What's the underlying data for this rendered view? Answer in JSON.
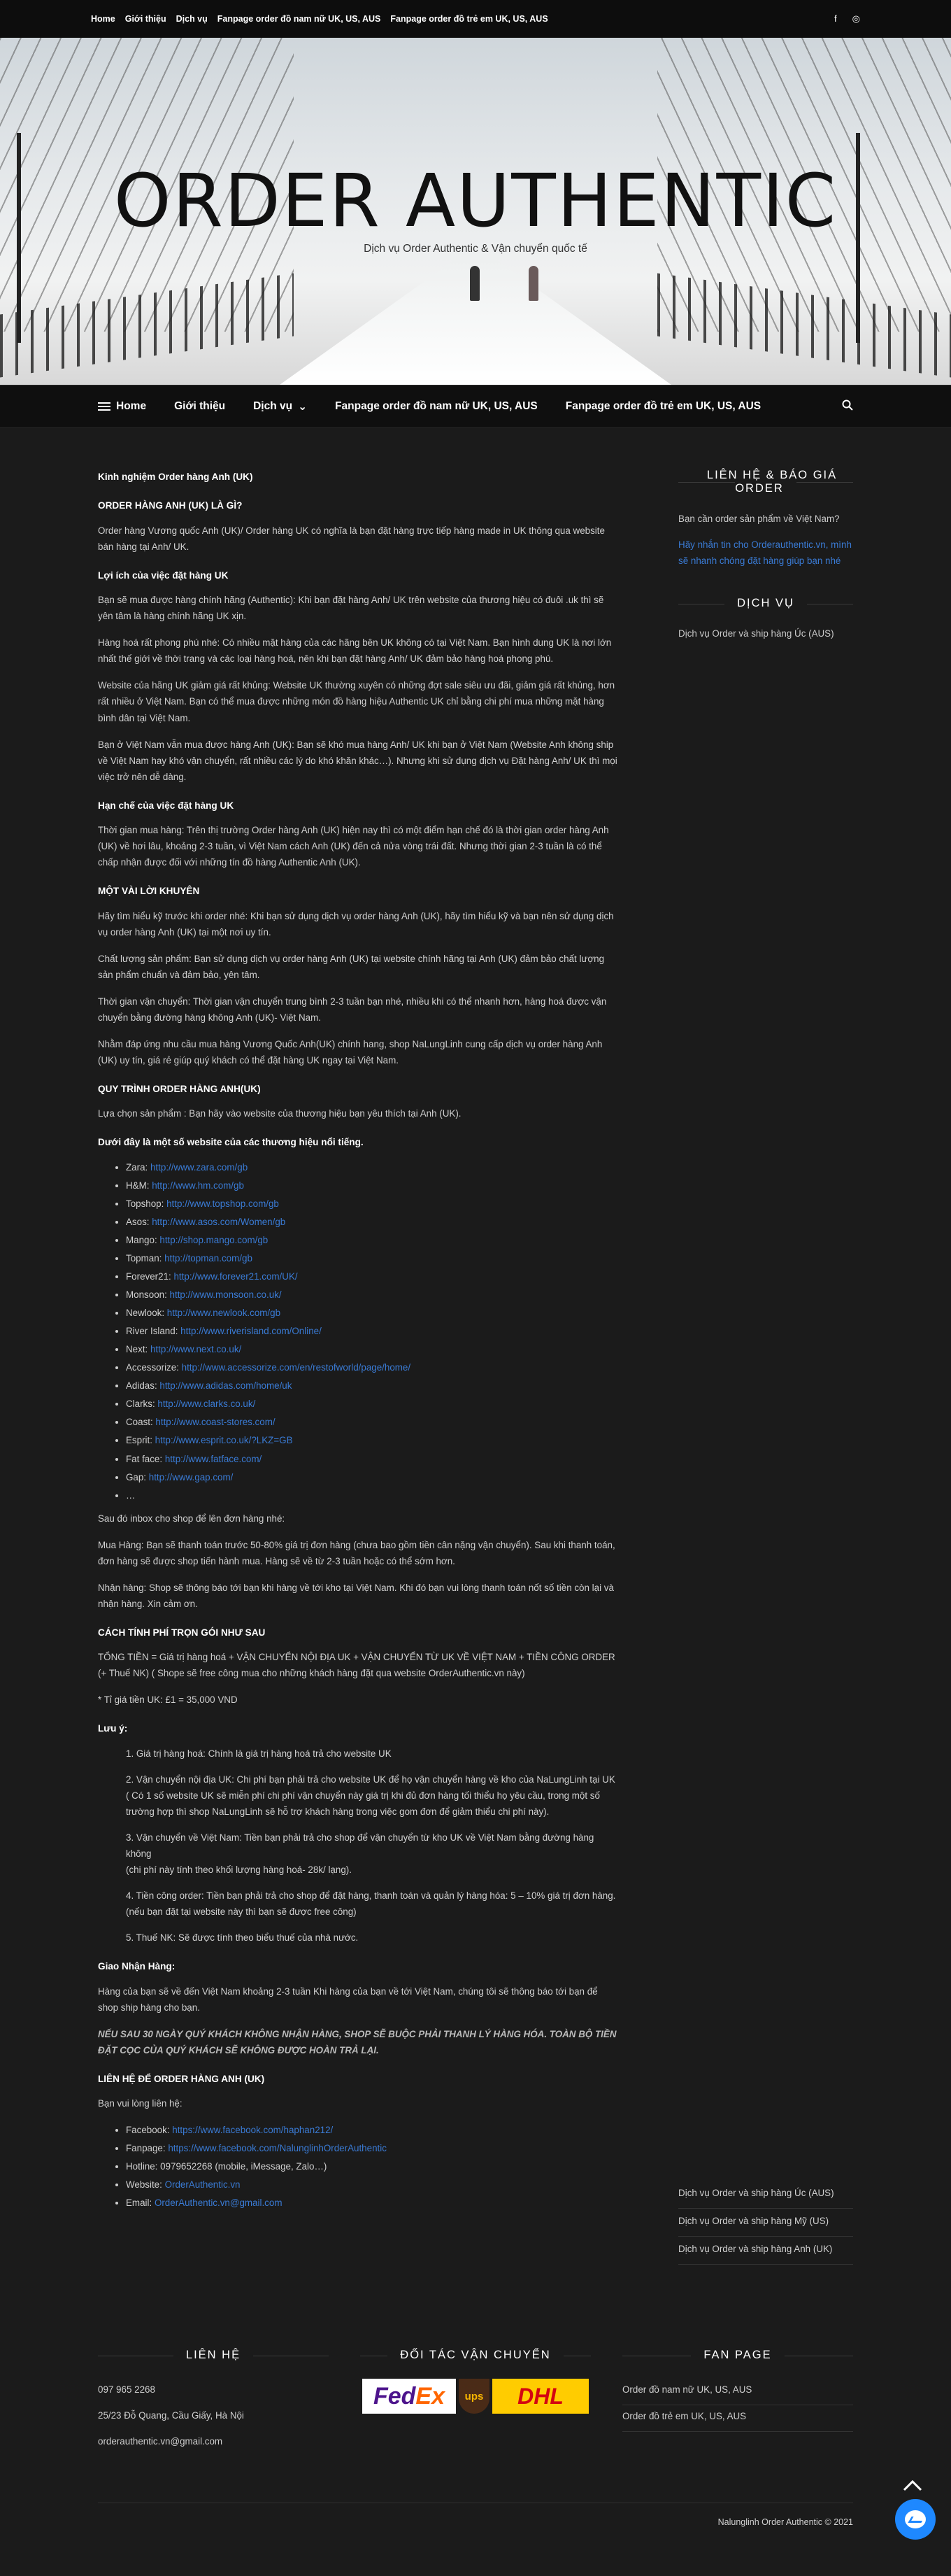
{
  "topbar": {
    "menu": [
      "Home",
      "Giới thiệu",
      "Dịch vụ",
      "Fanpage order đồ nam nữ UK, US, AUS",
      "Fanpage order đồ trẻ em UK, US, AUS"
    ],
    "social": [
      "f",
      "◎"
    ]
  },
  "hero": {
    "title": "ORDER AUTHENTIC",
    "tagline": "Dịch vụ Order Authentic & Vận chuyển quốc tế"
  },
  "mainnav": {
    "home": "Home",
    "about": "Giới thiệu",
    "services": "Dịch vụ",
    "fanpage1": "Fanpage order đồ nam nữ UK, US, AUS",
    "fanpage2": "Fanpage order đồ trẻ em UK, US, AUS"
  },
  "article": {
    "h_main": "Kinh nghiệm Order hàng Anh (UK)",
    "h_what": "ORDER HÀNG ANH (UK) LÀ GÌ?",
    "p_what": "Order hàng Vương quốc Anh (UK)/ Order hàng UK có nghĩa là bạn đặt hàng trực tiếp hàng made in UK thông qua website bán hàng tại Anh/ UK.",
    "h_benefit": "Lợi ích của việc đặt hàng UK",
    "p_b1": "Bạn sẽ mua được hàng chính hãng (Authentic): Khi bạn đặt hàng Anh/ UK trên website của thương hiệu có đuôi .uk thì sẽ yên tâm là hàng chính hãng UK xịn.",
    "p_b2": "Hàng hoá rất phong phú nhé: Có nhiều mặt hàng của các hãng bên UK không có tại Việt Nam. Bạn hình dung UK là nơi lớn nhất thế giới về thời trang và các loại hàng hoá, nên khi bạn đặt hàng Anh/ UK đảm bảo hàng hoá phong phú.",
    "p_b3": "Website của hãng UK giảm giá rất khủng: Website UK thường xuyên có những đợt sale siêu ưu đãi, giảm giá rất khủng, hơn rất nhiều ở Việt Nam. Bạn có thể mua được những món đồ hàng hiệu Authentic UK chỉ bằng chi phí mua những mặt hàng bình dân tại Việt Nam.",
    "p_b4": "Bạn ở Việt Nam vẫn mua được hàng Anh (UK): Bạn sẽ khó mua hàng Anh/ UK khi bạn ở Việt Nam (Website Anh không ship về Việt Nam hay khó vận chuyển, rất nhiều các lý do khó khăn khác…). Nhưng khi sử dụng dịch vụ Đặt hàng Anh/ UK thì mọi việc trở nên dễ dàng.",
    "h_limit": "Hạn chế của việc đặt hàng UK",
    "p_limit": "Thời gian mua hàng: Trên thị trường Order hàng Anh (UK) hiện nay thì có một điểm hạn chế đó là thời gian order hàng Anh (UK) về hơi lâu, khoảng 2-3 tuần, vì Việt Nam cách Anh (UK) đến cả nửa vòng trái đất. Nhưng thời gian 2-3 tuần là có thể chấp nhận được đối với những tín đồ hàng Authentic Anh (UK).",
    "h_advice": "MỘT VÀI LỜI KHUYÊN",
    "p_a1": "Hãy tìm hiểu kỹ trước khi order nhé: Khi bạn sử dụng dịch vụ order hàng Anh (UK), hãy tìm hiểu kỹ và bạn nên sử dụng dịch vụ order hàng Anh (UK) tại một nơi uy tín.",
    "p_a2": "Chất lượng sản phẩm: Bạn sử dụng dịch vụ order hàng Anh (UK) tại website chính hãng tại Anh (UK) đảm bảo chất lượng sản phẩm chuẩn và đảm bảo, yên tâm.",
    "p_a3": "Thời gian vận chuyển: Thời gian vận chuyển trung bình 2-3 tuần bạn nhé, nhiều khi có thể nhanh hơn, hàng hoá được vận chuyển bằng đường hàng không Anh (UK)- Việt Nam.",
    "p_a4": "Nhằm đáp ứng nhu cầu mua hàng Vương Quốc Anh(UK) chính hang, shop NaLungLinh cung cấp dịch vụ order hàng Anh (UK) uy tín, giá rẻ giúp quý khách có thể đặt hàng UK ngay tại Việt Nam.",
    "h_process": "QUY TRÌNH ORDER HÀNG ANH(UK)",
    "p_process": "Lựa chọn sản phẩm : Bạn hãy vào website của thương hiệu bạn yêu thích tại Anh (UK).",
    "h_brands": "Dưới đây là một số website của các thương hiệu nổi tiếng.",
    "brands": [
      {
        "name": "Zara: ",
        "url": "http://www.zara.com/gb"
      },
      {
        "name": "H&M: ",
        "url": "http://www.hm.com/gb"
      },
      {
        "name": "Topshop: ",
        "url": "http://www.topshop.com/gb"
      },
      {
        "name": "Asos: ",
        "url": "http://www.asos.com/Women/gb"
      },
      {
        "name": "Mango: ",
        "url": "http://shop.mango.com/gb"
      },
      {
        "name": "Topman: ",
        "url": "http://topman.com/gb"
      },
      {
        "name": "Forever21: ",
        "url": "http://www.forever21.com/UK/"
      },
      {
        "name": "Monsoon: ",
        "url": "http://www.monsoon.co.uk/"
      },
      {
        "name": "Newlook: ",
        "url": "http://www.newlook.com/gb"
      },
      {
        "name": "River Island: ",
        "url": "http://www.riverisland.com/Online/"
      },
      {
        "name": "Next: ",
        "url": "http://www.next.co.uk/"
      },
      {
        "name": "Accessorize: ",
        "url": "http://www.accessorize.com/en/restofworld/page/home/"
      },
      {
        "name": "Adidas: ",
        "url": "http://www.adidas.com/home/uk"
      },
      {
        "name": "Clarks: ",
        "url": "http://www.clarks.co.uk/"
      },
      {
        "name": "Coast: ",
        "url": "http://www.coast-stores.com/"
      },
      {
        "name": "Esprit: ",
        "url": "http://www.esprit.co.uk/?LKZ=GB"
      },
      {
        "name": "Fat face: ",
        "url": "http://www.fatface.com/"
      },
      {
        "name": "Gap: ",
        "url": "http://www.gap.com/"
      },
      {
        "name": "…",
        "url": ""
      }
    ],
    "p_after": "Sau đó inbox cho shop để lên đơn hàng nhé:",
    "p_buy": "Mua Hàng: Bạn sẽ thanh toán trước 50-80% giá trị đơn hàng (chưa bao gồm tiền cân nặng vận chuyển). Sau khi thanh toán, đơn hàng sẽ được shop tiến hành mua. Hàng sẽ về từ 2-3 tuần hoặc có thể sớm hơn.",
    "p_receive": "Nhận hàng: Shop sẽ thông báo tới bạn khi hàng về tới kho tại Việt Nam. Khi đó bạn vui lòng thanh toán nốt số tiền còn lại và nhận hàng. Xin cảm ơn.",
    "h_fee": "CÁCH TÍNH PHÍ TRỌN GÓI NHƯ SAU",
    "p_fee": "TỔNG TIỀN = Giá trị hàng hoá + VẬN CHUYỂN NỘI ĐỊA UK + VẬN CHUYỂN TỪ UK VỀ VIỆT NAM + TIỀN CÔNG ORDER (+ Thuế NK) ( Shope sẽ free công mua cho những khách hàng đặt qua website OrderAuthentic.vn này)",
    "p_rate": "* Tỉ giá tiền UK: £1 = 35,000 VND",
    "h_note": "Lưu ý:",
    "notes": [
      "1. Giá trị hàng hoá: Chính là giá trị hàng hoá trả cho website UK",
      "2. Vận chuyển nội địa UK: Chi phí bạn phải trả cho website UK để họ vận chuyển hàng về kho của NaLungLinh tại UK ( Có 1 số website UK sẽ miễn phí chi phí vận chuyển này giá trị khi đủ đơn hàng tối thiểu họ yêu cầu, trong một số trường hợp thì shop NaLungLinh sẽ hỗ trợ khách hàng trong việc gom đơn để giảm thiểu chi phí này).",
      "3. Vận chuyển về Việt Nam: Tiền bạn phải trả cho shop để vận chuyển từ kho UK về Việt Nam bằng đường hàng không\n(chi phí này tính theo khối lượng hàng hoá- 28k/ lạng).",
      "4. Tiền công order: Tiền bạn phải trả cho shop để đặt hàng, thanh toán và quản lý hàng hóa: 5 – 10% giá trị đơn hàng. (nếu bạn đặt tại website này thì bạn sẽ được free công)",
      "5. Thuế NK: Sẽ được tính theo biểu thuế của nhà nước."
    ],
    "h_delivery": "Giao Nhận Hàng:",
    "p_delivery": "Hàng của bạn sẽ về đến Việt Nam khoảng 2-3 tuần Khi hàng của bạn về tới Việt Nam, chúng tôi sẽ thông báo tới bạn để shop ship hàng cho bạn.",
    "p_warn": "NẾU SAU 30 NGÀY QUÝ KHÁCH KHÔNG NHẬN HÀNG, SHOP SẼ BUỘC PHẢI THANH LÝ HÀNG HÓA. TOÀN BỘ TIỀN ĐẶT CỌC CỦA QUÝ KHÁCH SẼ KHÔNG ĐƯỢC HOÀN TRẢ LẠI.",
    "h_contact": "LIÊN HỆ ĐỂ ORDER HÀNG ANH (UK)",
    "p_contact": "Bạn vui lòng liên hệ:",
    "contacts": [
      {
        "label": "Facebook: ",
        "value": "https://www.facebook.com/haphan212/",
        "link": true
      },
      {
        "label": "Fanpage: ",
        "value": "https://www.facebook.com/NalunglinhOrderAuthentic",
        "link": true
      },
      {
        "label": "Hotline: ",
        "value": "0979652268 (mobile, iMessage, Zalo…)",
        "link": false
      },
      {
        "label": "Website: ",
        "value": "OrderAuthentic.vn",
        "link": true
      },
      {
        "label": "Email: ",
        "value": "OrderAuthentic.vn@gmail.com",
        "link": true
      }
    ]
  },
  "sidebar": {
    "contact_title": "LIÊN HỆ & BÁO GIÁ ORDER",
    "contact_q": "Bạn cần order sản phẩm về Việt Nam?",
    "contact_link": "Hãy nhắn tin cho Orderauthentic.vn, mình sẽ nhanh chóng đặt hàng giúp bạn nhé",
    "service_title": "DỊCH VỤ",
    "service_link": "Dịch vụ Order và ship hàng Úc (AUS)",
    "bottom_links": [
      "Dịch vụ Order và ship hàng Úc (AUS)",
      "Dịch vụ Order và ship hàng Mỹ (US)",
      "Dịch vụ Order và ship hàng Anh (UK)"
    ]
  },
  "footer": {
    "contact_title": "LIÊN HỆ",
    "phone": "097 965 2268",
    "address": "25/23 Đỗ Quang, Cầu Giấy, Hà Nội",
    "email": "orderauthentic.vn@gmail.com",
    "partner_title": "ĐỐI TÁC VẬN CHUYỂN",
    "logo_fedex_fe": "Fed",
    "logo_fedex_ex": "Ex",
    "logo_ups": "ups",
    "logo_dhl": "DHL",
    "fanpage_title": "FAN PAGE",
    "fanpage1": "Order đồ nam nữ UK, US, AUS",
    "fanpage2": "Order đồ trẻ em UK, US, AUS",
    "copyright": "Nalunglinh Order Authentic © 2021"
  },
  "icons": {
    "totop": "chevron-up-icon",
    "chat": "messenger-icon",
    "search": "search-icon"
  }
}
